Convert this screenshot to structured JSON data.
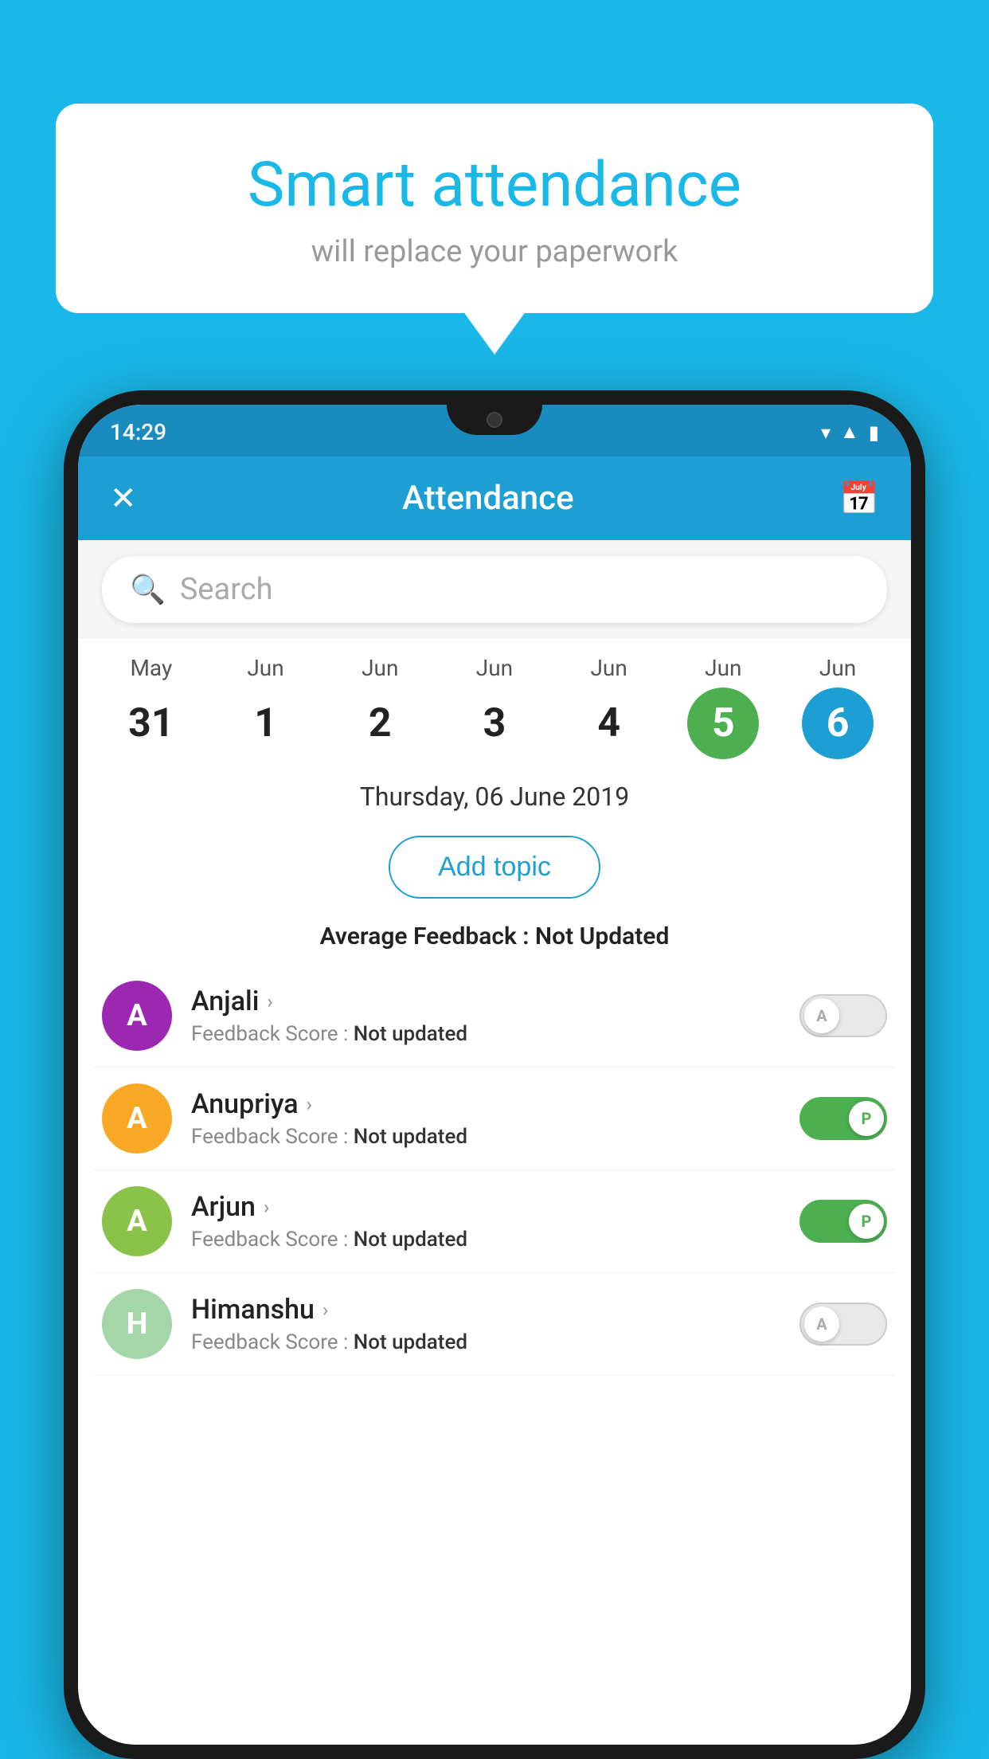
{
  "background": {
    "color": "#1ab8e8"
  },
  "speech_bubble": {
    "title": "Smart attendance",
    "subtitle": "will replace your paperwork"
  },
  "phone": {
    "status_bar": {
      "time": "14:29",
      "icons": [
        "wifi",
        "signal",
        "battery"
      ]
    },
    "app_bar": {
      "title": "Attendance",
      "close_icon": "✕",
      "calendar_icon": "📅"
    },
    "search": {
      "placeholder": "Search"
    },
    "calendar": {
      "days": [
        {
          "month": "May",
          "num": "31",
          "state": "normal"
        },
        {
          "month": "Jun",
          "num": "1",
          "state": "normal"
        },
        {
          "month": "Jun",
          "num": "2",
          "state": "normal"
        },
        {
          "month": "Jun",
          "num": "3",
          "state": "normal"
        },
        {
          "month": "Jun",
          "num": "4",
          "state": "normal"
        },
        {
          "month": "Jun",
          "num": "5",
          "state": "today"
        },
        {
          "month": "Jun",
          "num": "6",
          "state": "selected"
        }
      ]
    },
    "selected_date": "Thursday, 06 June 2019",
    "add_topic_label": "Add topic",
    "avg_feedback": {
      "label": "Average Feedback : ",
      "value": "Not Updated"
    },
    "students": [
      {
        "name": "Anjali",
        "feedback": "Not updated",
        "avatar_letter": "A",
        "avatar_color": "#9c27b0",
        "toggle_state": "off",
        "toggle_label": "A"
      },
      {
        "name": "Anupriya",
        "feedback": "Not updated",
        "avatar_letter": "A",
        "avatar_color": "#f9a825",
        "toggle_state": "on",
        "toggle_label": "P"
      },
      {
        "name": "Arjun",
        "feedback": "Not updated",
        "avatar_letter": "A",
        "avatar_color": "#8bc34a",
        "toggle_state": "on",
        "toggle_label": "P"
      },
      {
        "name": "Himanshu",
        "feedback": "Not updated",
        "avatar_letter": "H",
        "avatar_color": "#a5d6a7",
        "toggle_state": "off",
        "toggle_label": "A"
      }
    ]
  }
}
